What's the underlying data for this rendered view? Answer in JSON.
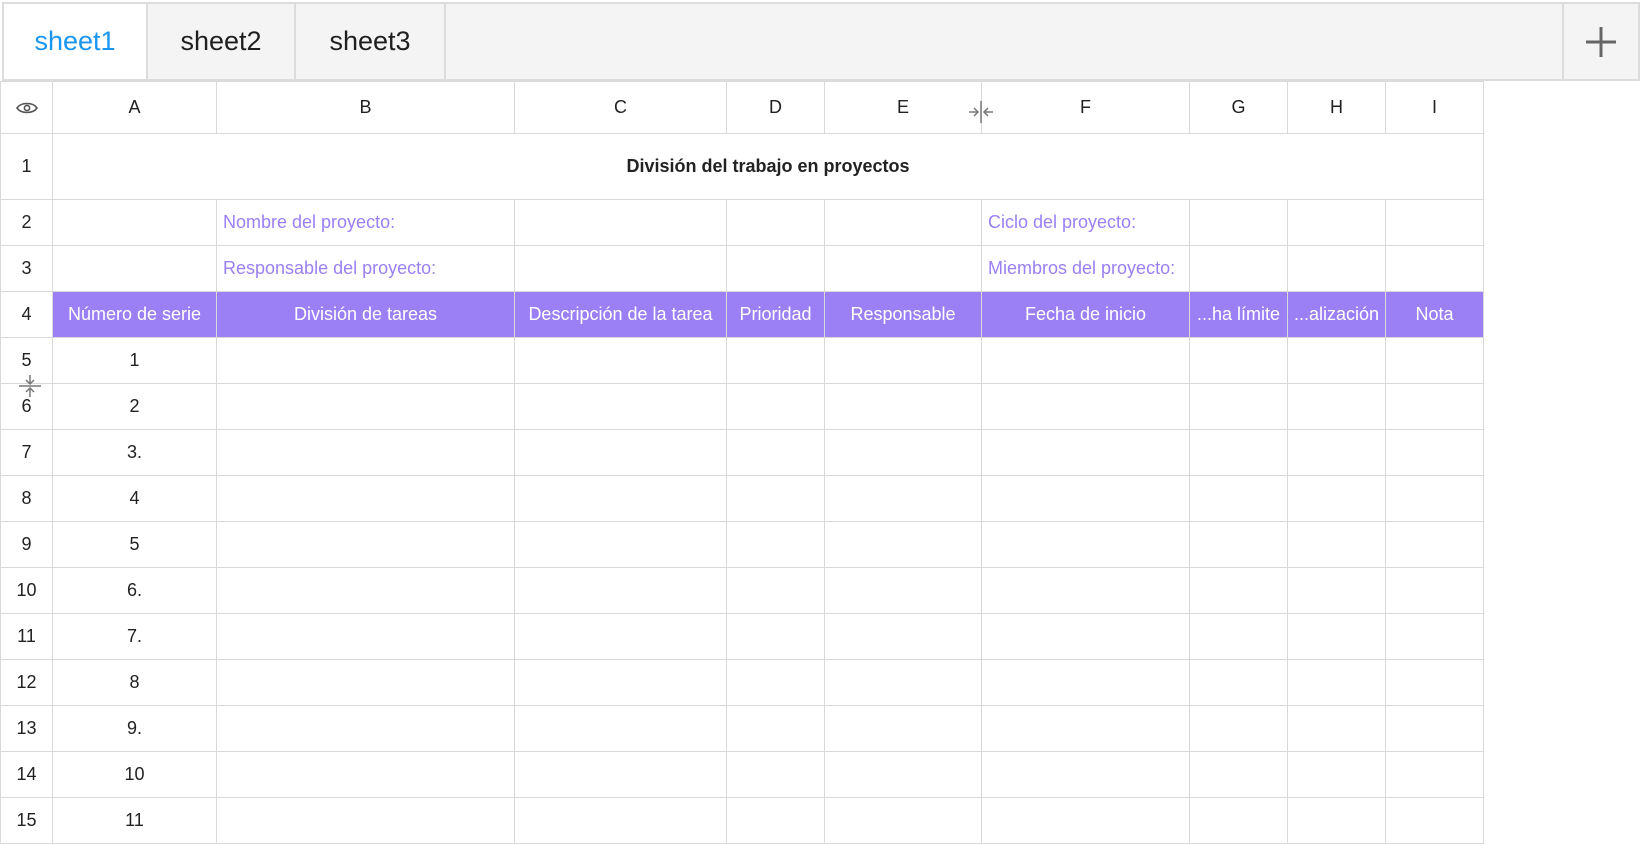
{
  "tabs": [
    {
      "label": "sheet1",
      "active": true
    },
    {
      "label": "sheet2",
      "active": false
    },
    {
      "label": "sheet3",
      "active": false
    }
  ],
  "add_sheet_icon": "plus-icon",
  "columns": [
    "A",
    "B",
    "C",
    "D",
    "E",
    "F",
    "G",
    "H",
    "I"
  ],
  "row_numbers": [
    "1",
    "2",
    "3",
    "4",
    "5",
    "6",
    "7",
    "8",
    "9",
    "10",
    "11",
    "12",
    "13",
    "14",
    "15"
  ],
  "title": "División del trabajo en proyectos",
  "meta": {
    "project_name_label": "Nombre del proyecto:",
    "project_cycle_label": "Ciclo del proyecto:",
    "project_owner_label": "Responsable del proyecto:",
    "project_members_label": "Miembros del proyecto:"
  },
  "headers": [
    "Número de serie",
    "División de tareas",
    "Descripción de la tarea",
    "Prioridad",
    "Responsable",
    "Fecha de inicio",
    "...ha límite",
    "...alización",
    "Nota"
  ],
  "serials": [
    "1",
    "2",
    "3.",
    "4",
    "5",
    "6.",
    "7.",
    "8",
    "9.",
    "10",
    "11"
  ],
  "colors": {
    "accent": "#9b7ff4",
    "active_tab": "#1a96f0",
    "grid_line": "#d9d9d9"
  }
}
